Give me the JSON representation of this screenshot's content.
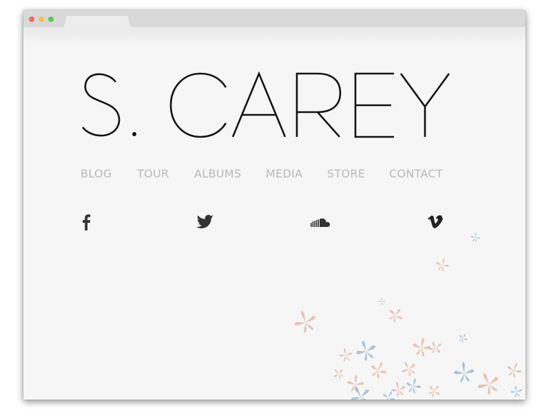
{
  "site": {
    "logo_text": "S. CAREY",
    "nav": {
      "items": [
        {
          "label": "BLOG"
        },
        {
          "label": "TOUR"
        },
        {
          "label": "ALBUMS"
        },
        {
          "label": "MEDIA"
        },
        {
          "label": "STORE"
        },
        {
          "label": "CONTACT"
        }
      ]
    },
    "social": [
      "facebook-icon",
      "twitter-icon",
      "soundcloud-icon",
      "vimeo-icon"
    ]
  },
  "colors": {
    "page_bg": "#f6f6f6",
    "logo": "#111111",
    "nav_text": "#b9b9b9",
    "icon": "#333333",
    "leaf_blue": "#8fb4cc",
    "leaf_peach": "#e3b29d"
  }
}
